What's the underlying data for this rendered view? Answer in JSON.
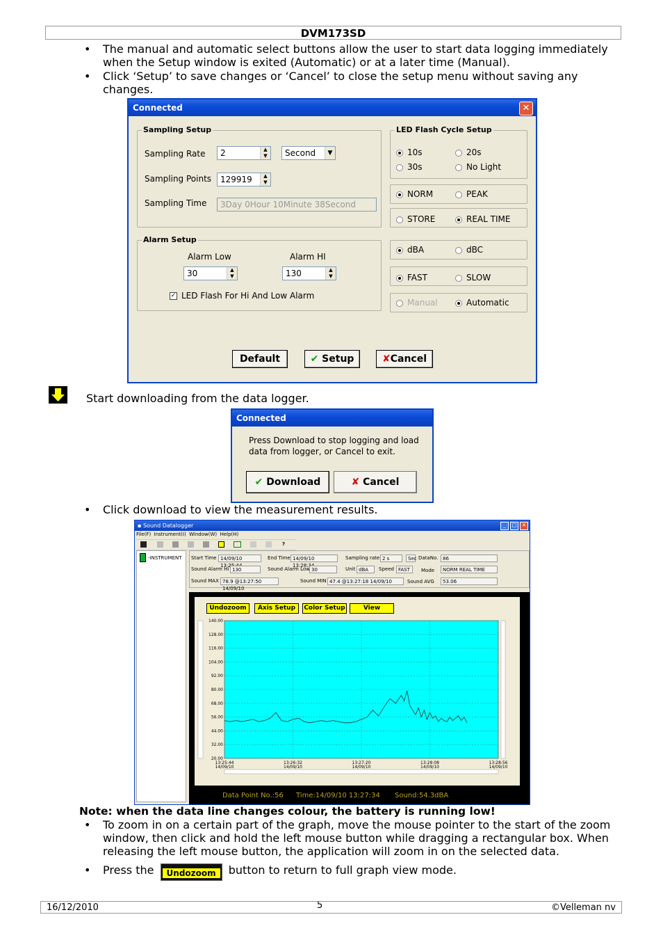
{
  "header": {
    "title": "DVM173SD"
  },
  "intro_bullets": [
    "The manual and automatic select buttons allow the user to start data logging immediately when the Setup window is exited (Automatic) or at a later time (Manual).",
    "Click ‘Setup’ to save changes or ‘Cancel’ to close the setup menu without saving any changes."
  ],
  "setup_dialog": {
    "title": "Connected",
    "sampling": {
      "legend": "Sampling Setup",
      "rate_label": "Sampling Rate",
      "rate_value": "2",
      "rate_unit": "Second",
      "points_label": "Sampling Points",
      "points_value": "129919",
      "time_label": "Sampling Time",
      "time_value": "3Day 0Hour 10Minute 38Second"
    },
    "led": {
      "legend": "LED Flash Cycle Setup",
      "opt_10s": "10s",
      "opt_20s": "20s",
      "opt_30s": "30s",
      "opt_nolight": "No Light"
    },
    "mode": {
      "norm": "NORM",
      "peak": "PEAK"
    },
    "store": {
      "store": "STORE",
      "realtime": "REAL TIME"
    },
    "weight": {
      "dba": "dBA",
      "dbc": "dBC"
    },
    "speed": {
      "fast": "FAST",
      "slow": "SLOW"
    },
    "start": {
      "manual": "Manual",
      "automatic": "Automatic"
    },
    "alarm": {
      "legend": "Alarm Setup",
      "low_label": "Alarm Low",
      "hi_label": "Alarm HI",
      "low_value": "30",
      "hi_value": "130",
      "led_flash": "LED Flash For Hi And Low  Alarm"
    },
    "buttons": {
      "default": "Default",
      "setup": "Setup",
      "cancel": "Cancel"
    }
  },
  "download_step": {
    "text": "Start downloading from the data logger."
  },
  "download_dialog": {
    "title": "Connected",
    "message": "Press Download to stop logging and load data from logger, or Cancel to exit.",
    "download": "Download",
    "cancel": "Cancel"
  },
  "view_bullet": "Click download to view the measurement results.",
  "datalogger": {
    "title": "Sound Datalogger",
    "menu": [
      "File(F)",
      "Instrument(I)",
      "Window(W)",
      "Help(H)"
    ],
    "tree_item": "INSTRUMENT",
    "fields": {
      "start_time_label": "Start Time",
      "start_time": "14/09/10 13:25:44",
      "end_time_label": "End Time",
      "end_time": "14/09/10 13:28:34",
      "rate_label": "Sampling rate",
      "rate": "2 s",
      "rate_unit": "Sec",
      "datano_label": "DataNo.",
      "datano": "86",
      "alarm_hi_label": "Sound Alarm Hi",
      "alarm_hi": "130",
      "alarm_low_label": "Sound Alarm Low",
      "alarm_low": "30",
      "unit_label": "Unit",
      "unit": "dBA",
      "speed_label": "Speed",
      "speed": "FAST",
      "mode_label": "Mode",
      "mode": "NORM REAL TIME",
      "max_label": "Sound MAX",
      "max": "78.9 @13:27:50 14/09/10",
      "min_label": "Sound MIN",
      "min": "47.4 @13:27:18 14/09/10",
      "avg_label": "Sound AVG",
      "avg": "53.06"
    },
    "chart_buttons": [
      "Undozoom",
      "Axis Setup",
      "Color Setup",
      "View"
    ],
    "status": {
      "point": "Data Point No.:56",
      "time": "Time:14/09/10 13:27:34",
      "sound": "Sound:54.3dBA"
    },
    "colors": {
      "plot_bg": "#00ffff",
      "frame": "#000000",
      "panel": "#f0ecd8",
      "accent": "#ffff00"
    }
  },
  "chart_data": {
    "type": "line",
    "title": "",
    "xlabel": "",
    "ylabel": "",
    "ylim": [
      20,
      140
    ],
    "yticks": [
      "20.00",
      "32.00",
      "44.00",
      "56.00",
      "68.00",
      "80.00",
      "92.00",
      "104.00",
      "116.00",
      "128.00",
      "140.00"
    ],
    "xticks": [
      {
        "time": "13:25:44",
        "date": "14/09/10"
      },
      {
        "time": "13:26:32",
        "date": "14/09/10"
      },
      {
        "time": "13:27:20",
        "date": "14/09/10"
      },
      {
        "time": "13:28:08",
        "date": "14/09/10"
      },
      {
        "time": "13:28:56",
        "date": "14/09/10"
      }
    ],
    "xlim_seconds_from_start": [
      0,
      192
    ],
    "series": [
      {
        "x": [
          0,
          4,
          8,
          12,
          16,
          20,
          24,
          28,
          32,
          36,
          40,
          44,
          48,
          52,
          56,
          60,
          64,
          68,
          72,
          76,
          80,
          84,
          88,
          92,
          96,
          100,
          104,
          108,
          112,
          116,
          120,
          124,
          126,
          128,
          130,
          132,
          134,
          136,
          138,
          140,
          142,
          144,
          146,
          148,
          150,
          152,
          154,
          156,
          158,
          160,
          162,
          164,
          166,
          168,
          170
        ],
        "y": [
          53,
          52,
          53,
          52,
          53,
          54,
          52,
          53,
          55,
          60,
          53,
          52,
          54,
          55,
          52,
          51,
          52,
          53,
          52,
          53,
          52,
          51,
          51,
          52,
          54,
          56,
          62,
          57,
          65,
          72,
          68,
          75,
          70,
          79,
          66,
          62,
          58,
          64,
          56,
          62,
          54,
          60,
          55,
          57,
          52,
          55,
          53,
          52,
          56,
          53,
          55,
          57,
          53,
          56,
          51
        ]
      }
    ]
  },
  "note": "Note: when the data line changes colour, the battery is running low!",
  "zoom_bullets": {
    "first": "To zoom in on a certain part of the graph, move the mouse pointer to the start of the zoom window, then click and hold the left mouse button while dragging a rectangular box. When releasing the left mouse button, the application will zoom in on the selected data.",
    "second_pre": "Press the",
    "second_button": "Undozoom",
    "second_post": "button to return to full graph view mode."
  },
  "footer": {
    "date": "16/12/2010",
    "page": "5",
    "copyright": "©Velleman nv"
  }
}
